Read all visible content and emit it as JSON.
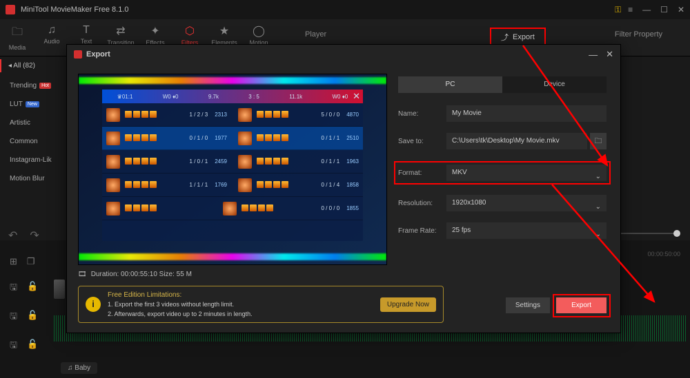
{
  "app": {
    "title": "MiniTool MovieMaker Free 8.1.0"
  },
  "winControls": {
    "min": "—",
    "max": "☐",
    "close": "✕",
    "menu": "≡"
  },
  "toolbar": [
    {
      "icon": "🗀",
      "label": "Media"
    },
    {
      "icon": "♫",
      "label": "Audio"
    },
    {
      "icon": "T",
      "label": "Text"
    },
    {
      "icon": "⇄",
      "label": "Transition"
    },
    {
      "icon": "✦",
      "label": "Effects"
    },
    {
      "icon": "⬡",
      "label": "Filters"
    },
    {
      "icon": "★",
      "label": "Elements"
    },
    {
      "icon": "◯",
      "label": "Motion"
    }
  ],
  "playerLabel": "Player",
  "exportTop": "Export",
  "filterProp": "Filter Property",
  "sidebar": {
    "all": "All (82)",
    "items": [
      {
        "label": "Trending",
        "badge": "Hot"
      },
      {
        "label": "LUT",
        "badge": "New"
      },
      {
        "label": "Artistic",
        "badge": ""
      },
      {
        "label": "Common",
        "badge": ""
      },
      {
        "label": "Instagram-Lik",
        "badge": ""
      },
      {
        "label": "Motion Blur",
        "badge": ""
      }
    ]
  },
  "modal": {
    "title": "Export",
    "tabs": {
      "pc": "PC",
      "device": "Device"
    },
    "fields": {
      "nameLabel": "Name:",
      "name": "My Movie",
      "saveLabel": "Save to:",
      "save": "C:\\Users\\tk\\Desktop\\My Movie.mkv",
      "formatLabel": "Format:",
      "format": "MKV",
      "resLabel": "Resolution:",
      "res": "1920x1080",
      "fpsLabel": "Frame Rate:",
      "fps": "25 fps"
    },
    "duration": "Duration: 00:00:55:10 Size: 55 M",
    "limitHead": "Free Edition Limitations:",
    "limit1": "1. Export the first 3 videos without length limit.",
    "limit2": "2. Afterwards, export video up to 2 minutes in length.",
    "upgrade": "Upgrade Now",
    "settings": "Settings",
    "export": "Export"
  },
  "preview": {
    "topStats": [
      "♛01:1",
      "W0 ♦0",
      "9.7k",
      "3 : 5",
      "11.1k",
      "W0 ♦0"
    ],
    "rows": [
      {
        "kda": "1 / 2 / 3",
        "num": "2313",
        "kda2": "5 / 0 / 0",
        "num2": "4870"
      },
      {
        "kda": "0 / 1 / 0",
        "num": "1977",
        "kda2": "0 / 1 / 1",
        "num2": "2510",
        "sel": true
      },
      {
        "kda": "1 / 0 / 1",
        "num": "2459",
        "kda2": "0 / 1 / 1",
        "num2": "1963"
      },
      {
        "kda": "1 / 1 / 1",
        "num": "1769",
        "kda2": "0 / 1 / 4",
        "num2": "1858"
      },
      {
        "kda": "",
        "num": "",
        "kda2": "0 / 0 / 0",
        "num2": "1855"
      }
    ]
  },
  "timeline": {
    "code1": "00:00:50:00",
    "track": "♫ Baby"
  }
}
